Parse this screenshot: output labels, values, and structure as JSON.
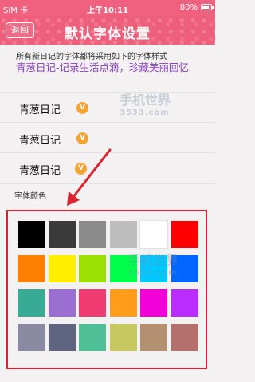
{
  "status_bar": {
    "carrier": "SIM 卡",
    "time": "上午10:11",
    "battery": "80%",
    "battery_level": 0.8
  },
  "nav": {
    "back_label": "返回",
    "title": "默认字体设置"
  },
  "info_text": "所有新日记的字体都将采用如下的字体样式",
  "sample_text": "青葱日记-记录生活点滴，珍藏美丽回忆",
  "font_options": [
    {
      "label": "青葱日记",
      "badge": "V"
    },
    {
      "label": "青葱日记",
      "badge": "V"
    },
    {
      "label": "青葱日记",
      "badge": "V"
    }
  ],
  "color_section_label": "字体颜色",
  "swatch_colors": [
    [
      "#000000",
      "#3a3a3a",
      "#8a8a8a",
      "#bdbdbd",
      "#ffffff",
      "#ff0000"
    ],
    [
      "#ff7f00",
      "#ffee00",
      "#9be000",
      "#00ff4a",
      "#00c8ff",
      "#0066ff"
    ],
    [
      "#38ab95",
      "#9a6fd1",
      "#ef3a72",
      "#ff9c1a",
      "#f400d8",
      "#bb2dff"
    ],
    [
      "#8a8aa3",
      "#5f6480",
      "#4fbf97",
      "#c7c960",
      "#b39070",
      "#b3706c"
    ]
  ],
  "watermark": {
    "text": "手机世界",
    "sub": "3533.com"
  },
  "colors": {
    "accent": "#ee5f7c",
    "highlight": "#d9242f",
    "badge": "#f5a431",
    "sample_text": "#8840c0"
  }
}
